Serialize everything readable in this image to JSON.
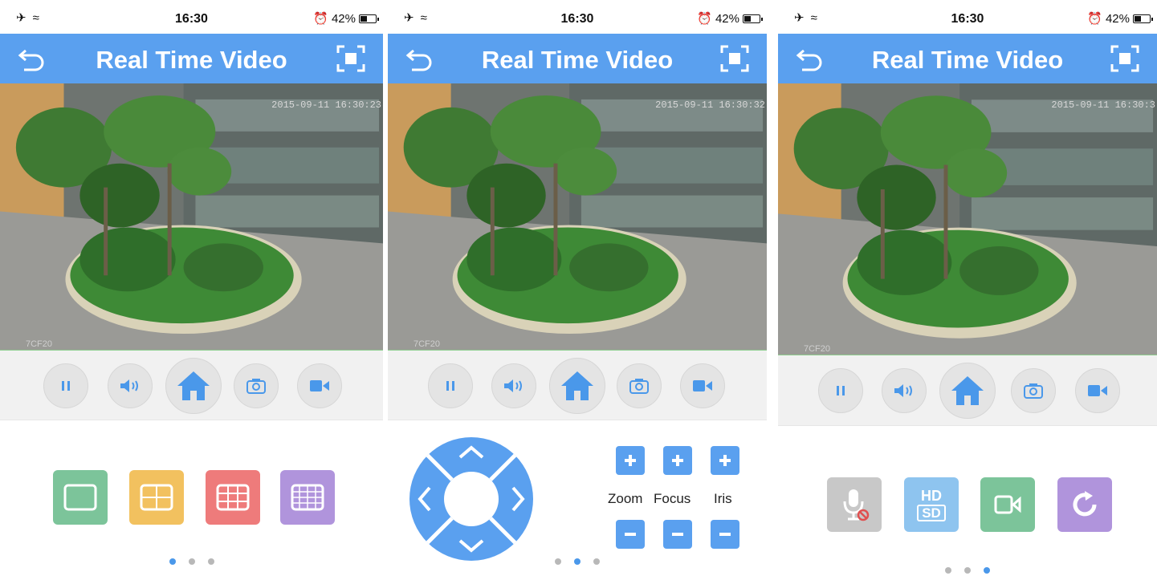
{
  "status": {
    "time": "16:30",
    "battery": "42%"
  },
  "header": {
    "title": "Real Time Video"
  },
  "screens": [
    {
      "timestamp": "2015-09-11 16:30:23",
      "camera": "7CF20",
      "active_page": 0
    },
    {
      "timestamp": "2015-09-11 16:30:32",
      "camera": "7CF20",
      "active_page": 1
    },
    {
      "timestamp": "2015-09-11 16:30:3",
      "camera": "7CF20",
      "active_page": 2
    }
  ],
  "controls": [
    "pause-icon",
    "speaker-icon",
    "home-icon",
    "camera-icon",
    "video-record-icon"
  ],
  "layouts": [
    "single-view-icon",
    "four-view-icon",
    "nine-view-icon",
    "sixteen-view-icon"
  ],
  "ptz": {
    "zoom": "Zoom",
    "focus": "Focus",
    "iris": "Iris"
  },
  "extras": [
    "mic-off-icon",
    "hd-sd-icon",
    "record-icon",
    "rotate-icon"
  ],
  "hdsd": {
    "hd": "HD",
    "sd": "SD"
  },
  "colors": {
    "header": "#5aa0ef",
    "accent": "#4a98ea",
    "green": "#7cc49a",
    "yellow": "#f2c15f",
    "red": "#ee7b7b",
    "purple": "#b094dc"
  }
}
